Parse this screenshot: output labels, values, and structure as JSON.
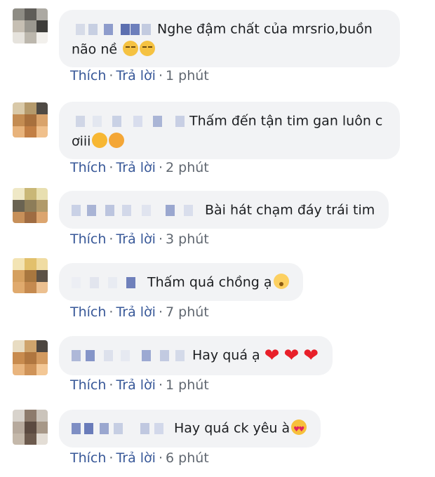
{
  "colors": {
    "bubble": "#f2f3f5",
    "link": "#385898",
    "muted": "#606770"
  },
  "action_labels": {
    "like": "Thích",
    "reply": "Trả lời",
    "dot": "·"
  },
  "comments": [
    {
      "text_line1": "Nghe đậm chất của mrsrio,buồn",
      "text_line2": "não nề",
      "time": "1 phút",
      "emoji": "pensive-face"
    },
    {
      "text_line1": "Thấm đến tận tim gan luôn c",
      "text_line2": "ơiii",
      "time": "2 phút",
      "emoji": "kissing-heart-face"
    },
    {
      "text_line1": "Bài hát chạm đáy trái tim",
      "time": "3 phút"
    },
    {
      "text_line1": "Thấm quá chồng ạ",
      "time": "7 phút",
      "emoji": "hushed-face"
    },
    {
      "text_line1": "Hay quá ạ",
      "time": "1 phút",
      "emoji": "red-heart"
    },
    {
      "text_line1": "Hay quá ck yêu à",
      "time": "6 phút",
      "emoji": "heart-eyes-face"
    }
  ]
}
